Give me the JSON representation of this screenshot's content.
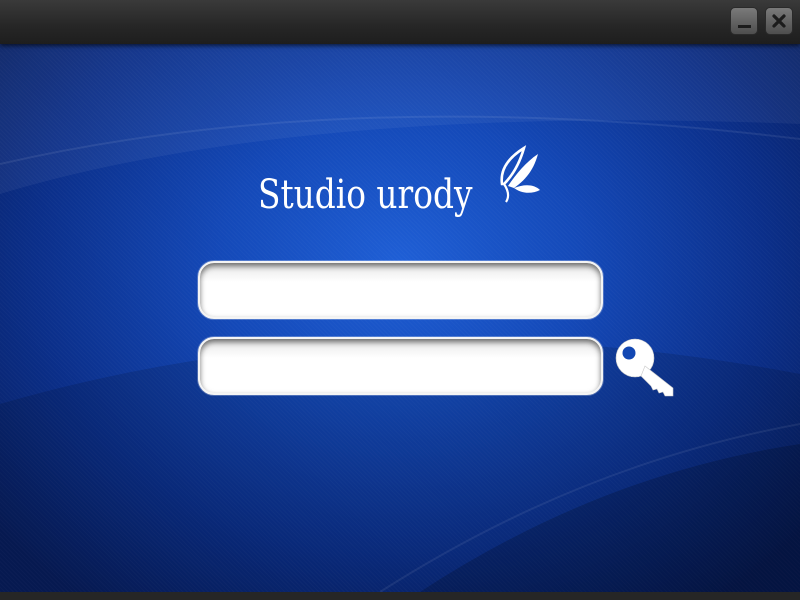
{
  "app": {
    "logo_text": "Studio urody"
  },
  "titlebar": {
    "buttons": [
      {
        "name": "minimize",
        "icon": "minimize-icon"
      },
      {
        "name": "close",
        "icon": "close-icon"
      }
    ]
  },
  "login": {
    "username": {
      "value": "",
      "placeholder": ""
    },
    "password": {
      "value": "",
      "placeholder": ""
    },
    "submit_icon": "key-icon"
  },
  "colors": {
    "background_center": "#1f5fd6",
    "background_edge": "#071d5c",
    "titlebar": "#262626",
    "field": "#ffffff",
    "text_light": "#ffffff"
  }
}
